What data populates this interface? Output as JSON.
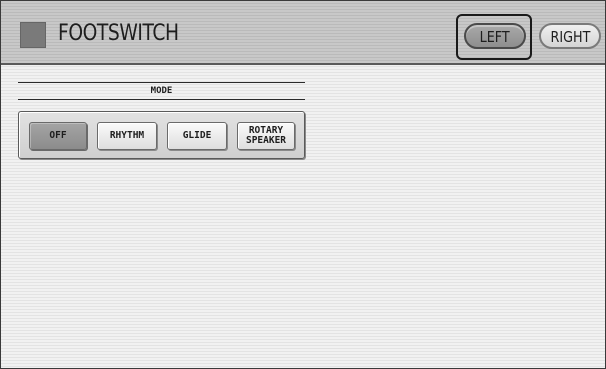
{
  "header": {
    "title": "FOOTSWITCH",
    "tabs": [
      {
        "label": "LEFT",
        "selected": true
      },
      {
        "label": "RIGHT",
        "selected": false
      }
    ]
  },
  "mode": {
    "heading": "MODE",
    "options": [
      {
        "label": "OFF",
        "selected": true
      },
      {
        "label": "RHYTHM",
        "selected": false
      },
      {
        "label": "GLIDE",
        "selected": false
      },
      {
        "label": "ROTARY\nSPEAKER",
        "selected": false
      }
    ]
  }
}
